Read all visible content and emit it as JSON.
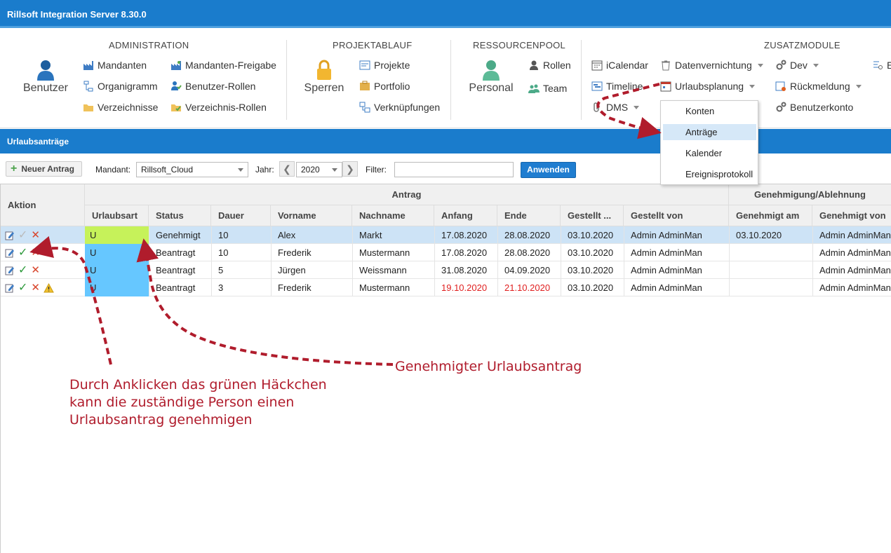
{
  "window": {
    "title": "Rillsoft Integration Server 8.30.0"
  },
  "ribbon": {
    "administration": {
      "header": "ADMINISTRATION",
      "big_label": "Benutzer",
      "items": [
        "Mandanten",
        "Organigramm",
        "Verzeichnisse",
        "Mandanten-Freigabe",
        "Benutzer-Rollen",
        "Verzeichnis-Rollen"
      ]
    },
    "projektablauf": {
      "header": "PROJEKTABLAUF",
      "big_label": "Sperren",
      "items": [
        "Projekte",
        "Portfolio",
        "Verknüpfungen"
      ]
    },
    "ressourcenpool": {
      "header": "RESSOURCENPOOL",
      "big_label": "Personal",
      "items": [
        "Rollen",
        "Team"
      ]
    },
    "zusatzmodule": {
      "header": "ZUSATZMODULE",
      "items": [
        "iCalendar",
        "Timeline",
        "DMS",
        "Datenvernichtung",
        "Urlaubsplanung",
        "Dev",
        "Rückmeldung",
        "Benutzerkonto"
      ],
      "cut_item": "E"
    }
  },
  "dropdown_menu": {
    "items": [
      "Konten",
      "Anträge",
      "Kalender",
      "Ereignisprotokoll"
    ],
    "selected": "Anträge"
  },
  "panel": {
    "title": "Urlaubsanträge"
  },
  "toolbar": {
    "new_button": "Neuer Antrag",
    "mandant_label": "Mandant:",
    "mandant_value": "Rillsoft_Cloud",
    "jahr_label": "Jahr:",
    "jahr_value": "2020",
    "prev": "❮",
    "next": "❯",
    "filter_label": "Filter:",
    "filter_value": "",
    "apply_button": "Anwenden"
  },
  "grid": {
    "group_headers": {
      "aktion": "Aktion",
      "antrag": "Antrag",
      "genehmigung": "Genehmigung/Ablehnung"
    },
    "columns": [
      "Urlaubsart",
      "Status",
      "Dauer",
      "Vorname",
      "Nachname",
      "Anfang",
      "Ende",
      "Gestellt ...",
      "Gestellt von",
      "Genehmigt am",
      "Genehmigt von"
    ],
    "rows": [
      {
        "urlaubsart": "U",
        "status": "Genehmigt",
        "dauer": "10",
        "vorname": "Alex",
        "nachname": "Markt",
        "anfang": "17.08.2020",
        "ende": "28.08.2020",
        "gestellt_am": "03.10.2020",
        "gestellt_von": "Admin AdminMan",
        "genehmigt_am": "03.10.2020",
        "genehmigt_von": "Admin AdminMan",
        "color": "#c6f25a",
        "selected": true,
        "warning": false,
        "highlight_dates": false
      },
      {
        "urlaubsart": "U",
        "status": "Beantragt",
        "dauer": "10",
        "vorname": "Frederik",
        "nachname": "Mustermann",
        "anfang": "17.08.2020",
        "ende": "28.08.2020",
        "gestellt_am": "03.10.2020",
        "gestellt_von": "Admin AdminMan",
        "genehmigt_am": "",
        "genehmigt_von": "Admin AdminMan",
        "color": "#66c7ff",
        "selected": false,
        "warning": false,
        "highlight_dates": false
      },
      {
        "urlaubsart": "U",
        "status": "Beantragt",
        "dauer": "5",
        "vorname": "Jürgen",
        "nachname": "Weissmann",
        "anfang": "31.08.2020",
        "ende": "04.09.2020",
        "gestellt_am": "03.10.2020",
        "gestellt_von": "Admin AdminMan",
        "genehmigt_am": "",
        "genehmigt_von": "Admin AdminMan",
        "color": "#66c7ff",
        "selected": false,
        "warning": false,
        "highlight_dates": false
      },
      {
        "urlaubsart": "U",
        "status": "Beantragt",
        "dauer": "3",
        "vorname": "Frederik",
        "nachname": "Mustermann",
        "anfang": "19.10.2020",
        "ende": "21.10.2020",
        "gestellt_am": "03.10.2020",
        "gestellt_von": "Admin AdminMan",
        "genehmigt_am": "",
        "genehmigt_von": "Admin AdminMan",
        "color": "#66c7ff",
        "selected": false,
        "warning": true,
        "highlight_dates": true
      }
    ]
  },
  "annotations": {
    "left_lines": [
      "Durch Anklicken das grünen Häckchen",
      "kann die zuständige Person einen",
      "Urlaubsantrag genehmigen"
    ],
    "right": "Genehmigter Urlaubsantrag"
  },
  "colors": {
    "accent": "#1a7ccc",
    "annotation": "#b01c2c",
    "approve": "#2e9a3c",
    "reject": "#d8452c"
  }
}
